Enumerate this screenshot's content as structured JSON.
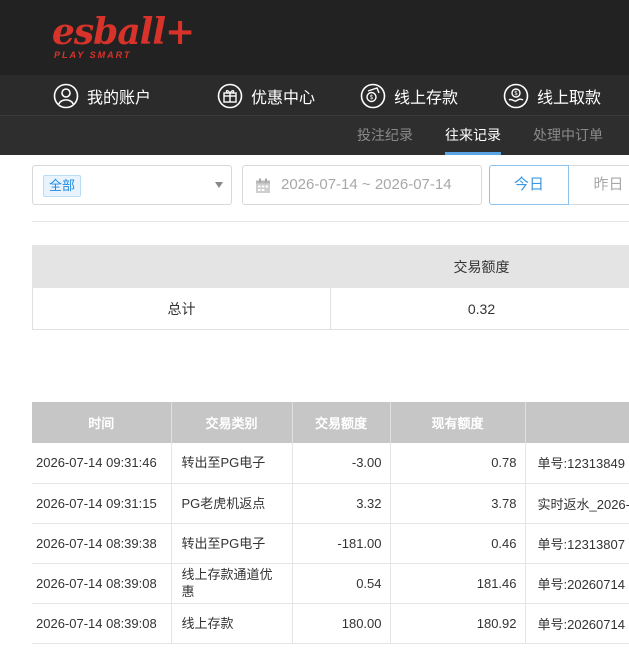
{
  "header": {
    "logo_text": "esball+",
    "logo_tagline": "PLAY SMART",
    "brand_color": "#d8332b"
  },
  "nav": {
    "items": [
      {
        "label": "我的账户",
        "icon": "user-icon"
      },
      {
        "label": "优惠中心",
        "icon": "gift-icon"
      },
      {
        "label": "线上存款",
        "icon": "deposit-icon"
      },
      {
        "label": "线上取款",
        "icon": "withdraw-icon"
      }
    ]
  },
  "subnav": {
    "tabs": [
      {
        "label": "投注纪录",
        "active": false
      },
      {
        "label": "往来记录",
        "active": true
      },
      {
        "label": "处理中订单",
        "active": false
      }
    ],
    "accent_color": "#5aa4e6"
  },
  "filters": {
    "type_selected": "全部",
    "date_range": "2026-07-14 ~ 2026-07-14",
    "today_label": "今日",
    "yesterday_label": "昨日"
  },
  "summary": {
    "header": "交易额度",
    "total_label": "总计",
    "total_value": "0.32"
  },
  "records": {
    "columns": [
      "时间",
      "交易类别",
      "交易额度",
      "现有额度",
      ""
    ],
    "rows": [
      {
        "time": "2026-07-14 09:31:46",
        "type": "转出至PG电子",
        "amount": "-3.00",
        "balance": "0.78",
        "note": "单号:12313849"
      },
      {
        "time": "2026-07-14 09:31:15",
        "type": "PG老虎机返点",
        "amount": "3.32",
        "balance": "3.78",
        "note": "实时返水_2026-"
      },
      {
        "time": "2026-07-14 08:39:38",
        "type": "转出至PG电子",
        "amount": "-181.00",
        "balance": "0.46",
        "note": "单号:12313807"
      },
      {
        "time": "2026-07-14 08:39:08",
        "type": "线上存款通道优惠",
        "amount": "0.54",
        "balance": "181.46",
        "note": "单号:20260714"
      },
      {
        "time": "2026-07-14 08:39:08",
        "type": "线上存款",
        "amount": "180.00",
        "balance": "180.92",
        "note": "单号:20260714"
      }
    ]
  }
}
